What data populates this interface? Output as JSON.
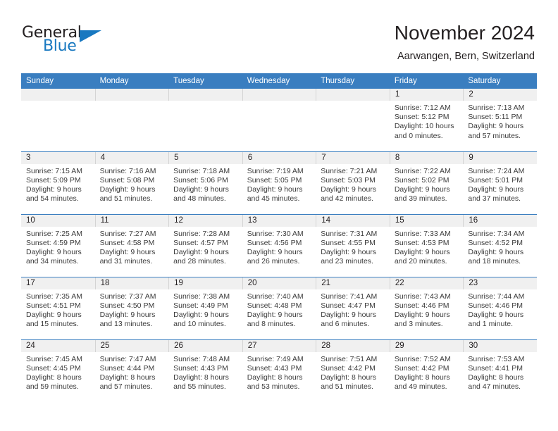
{
  "brand": {
    "name_part1": "General",
    "name_part2": "Blue",
    "accent_color": "#1878c0"
  },
  "header": {
    "title": "November 2024",
    "subtitle": "Aarwangen, Bern, Switzerland"
  },
  "calendar": {
    "header_color": "#3a7ec0",
    "daynum_band_color": "#f0f0f0",
    "weekdays": [
      "Sunday",
      "Monday",
      "Tuesday",
      "Wednesday",
      "Thursday",
      "Friday",
      "Saturday"
    ],
    "weeks": [
      [
        {
          "empty": true
        },
        {
          "empty": true
        },
        {
          "empty": true
        },
        {
          "empty": true
        },
        {
          "empty": true
        },
        {
          "day": "1",
          "sunrise": "Sunrise: 7:12 AM",
          "sunset": "Sunset: 5:12 PM",
          "daylight": "Daylight: 10 hours and 0 minutes."
        },
        {
          "day": "2",
          "sunrise": "Sunrise: 7:13 AM",
          "sunset": "Sunset: 5:11 PM",
          "daylight": "Daylight: 9 hours and 57 minutes."
        }
      ],
      [
        {
          "day": "3",
          "sunrise": "Sunrise: 7:15 AM",
          "sunset": "Sunset: 5:09 PM",
          "daylight": "Daylight: 9 hours and 54 minutes."
        },
        {
          "day": "4",
          "sunrise": "Sunrise: 7:16 AM",
          "sunset": "Sunset: 5:08 PM",
          "daylight": "Daylight: 9 hours and 51 minutes."
        },
        {
          "day": "5",
          "sunrise": "Sunrise: 7:18 AM",
          "sunset": "Sunset: 5:06 PM",
          "daylight": "Daylight: 9 hours and 48 minutes."
        },
        {
          "day": "6",
          "sunrise": "Sunrise: 7:19 AM",
          "sunset": "Sunset: 5:05 PM",
          "daylight": "Daylight: 9 hours and 45 minutes."
        },
        {
          "day": "7",
          "sunrise": "Sunrise: 7:21 AM",
          "sunset": "Sunset: 5:03 PM",
          "daylight": "Daylight: 9 hours and 42 minutes."
        },
        {
          "day": "8",
          "sunrise": "Sunrise: 7:22 AM",
          "sunset": "Sunset: 5:02 PM",
          "daylight": "Daylight: 9 hours and 39 minutes."
        },
        {
          "day": "9",
          "sunrise": "Sunrise: 7:24 AM",
          "sunset": "Sunset: 5:01 PM",
          "daylight": "Daylight: 9 hours and 37 minutes."
        }
      ],
      [
        {
          "day": "10",
          "sunrise": "Sunrise: 7:25 AM",
          "sunset": "Sunset: 4:59 PM",
          "daylight": "Daylight: 9 hours and 34 minutes."
        },
        {
          "day": "11",
          "sunrise": "Sunrise: 7:27 AM",
          "sunset": "Sunset: 4:58 PM",
          "daylight": "Daylight: 9 hours and 31 minutes."
        },
        {
          "day": "12",
          "sunrise": "Sunrise: 7:28 AM",
          "sunset": "Sunset: 4:57 PM",
          "daylight": "Daylight: 9 hours and 28 minutes."
        },
        {
          "day": "13",
          "sunrise": "Sunrise: 7:30 AM",
          "sunset": "Sunset: 4:56 PM",
          "daylight": "Daylight: 9 hours and 26 minutes."
        },
        {
          "day": "14",
          "sunrise": "Sunrise: 7:31 AM",
          "sunset": "Sunset: 4:55 PM",
          "daylight": "Daylight: 9 hours and 23 minutes."
        },
        {
          "day": "15",
          "sunrise": "Sunrise: 7:33 AM",
          "sunset": "Sunset: 4:53 PM",
          "daylight": "Daylight: 9 hours and 20 minutes."
        },
        {
          "day": "16",
          "sunrise": "Sunrise: 7:34 AM",
          "sunset": "Sunset: 4:52 PM",
          "daylight": "Daylight: 9 hours and 18 minutes."
        }
      ],
      [
        {
          "day": "17",
          "sunrise": "Sunrise: 7:35 AM",
          "sunset": "Sunset: 4:51 PM",
          "daylight": "Daylight: 9 hours and 15 minutes."
        },
        {
          "day": "18",
          "sunrise": "Sunrise: 7:37 AM",
          "sunset": "Sunset: 4:50 PM",
          "daylight": "Daylight: 9 hours and 13 minutes."
        },
        {
          "day": "19",
          "sunrise": "Sunrise: 7:38 AM",
          "sunset": "Sunset: 4:49 PM",
          "daylight": "Daylight: 9 hours and 10 minutes."
        },
        {
          "day": "20",
          "sunrise": "Sunrise: 7:40 AM",
          "sunset": "Sunset: 4:48 PM",
          "daylight": "Daylight: 9 hours and 8 minutes."
        },
        {
          "day": "21",
          "sunrise": "Sunrise: 7:41 AM",
          "sunset": "Sunset: 4:47 PM",
          "daylight": "Daylight: 9 hours and 6 minutes."
        },
        {
          "day": "22",
          "sunrise": "Sunrise: 7:43 AM",
          "sunset": "Sunset: 4:46 PM",
          "daylight": "Daylight: 9 hours and 3 minutes."
        },
        {
          "day": "23",
          "sunrise": "Sunrise: 7:44 AM",
          "sunset": "Sunset: 4:46 PM",
          "daylight": "Daylight: 9 hours and 1 minute."
        }
      ],
      [
        {
          "day": "24",
          "sunrise": "Sunrise: 7:45 AM",
          "sunset": "Sunset: 4:45 PM",
          "daylight": "Daylight: 8 hours and 59 minutes."
        },
        {
          "day": "25",
          "sunrise": "Sunrise: 7:47 AM",
          "sunset": "Sunset: 4:44 PM",
          "daylight": "Daylight: 8 hours and 57 minutes."
        },
        {
          "day": "26",
          "sunrise": "Sunrise: 7:48 AM",
          "sunset": "Sunset: 4:43 PM",
          "daylight": "Daylight: 8 hours and 55 minutes."
        },
        {
          "day": "27",
          "sunrise": "Sunrise: 7:49 AM",
          "sunset": "Sunset: 4:43 PM",
          "daylight": "Daylight: 8 hours and 53 minutes."
        },
        {
          "day": "28",
          "sunrise": "Sunrise: 7:51 AM",
          "sunset": "Sunset: 4:42 PM",
          "daylight": "Daylight: 8 hours and 51 minutes."
        },
        {
          "day": "29",
          "sunrise": "Sunrise: 7:52 AM",
          "sunset": "Sunset: 4:42 PM",
          "daylight": "Daylight: 8 hours and 49 minutes."
        },
        {
          "day": "30",
          "sunrise": "Sunrise: 7:53 AM",
          "sunset": "Sunset: 4:41 PM",
          "daylight": "Daylight: 8 hours and 47 minutes."
        }
      ]
    ]
  }
}
